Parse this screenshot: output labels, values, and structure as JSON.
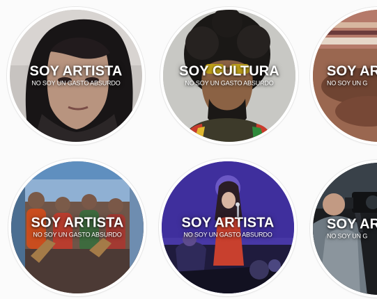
{
  "cards": [
    {
      "title": "SOY ARTISTA",
      "subtitle": "NO SOY UN GASTO ABSURDO",
      "image": "woman-with-long-dark-hair-portrait"
    },
    {
      "title": "SOY CULTURA",
      "subtitle": "NO SOY UN GASTO ABSURDO",
      "image": "man-with-curly-hair-and-sunglasses-portrait"
    },
    {
      "title": "SOY AR",
      "subtitle": "NO SOY UN G",
      "image": "person-with-knit-hat-closeup"
    },
    {
      "title": "SOY ARTISTA",
      "subtitle": "NO SOY UN GASTO ABSURDO",
      "image": "folk-music-band-with-ponchos"
    },
    {
      "title": "SOY ARTISTA",
      "subtitle": "NO SOY UN GASTO ABSURDO",
      "image": "singer-on-stage-purple-lights"
    },
    {
      "title": "SOY AR",
      "subtitle": "NO SOY UN G",
      "image": "camera-operator-filming"
    }
  ],
  "colors": {
    "background": "#fbfbfb",
    "caption_text": "#ffffff",
    "card_border": "#ffffff"
  }
}
